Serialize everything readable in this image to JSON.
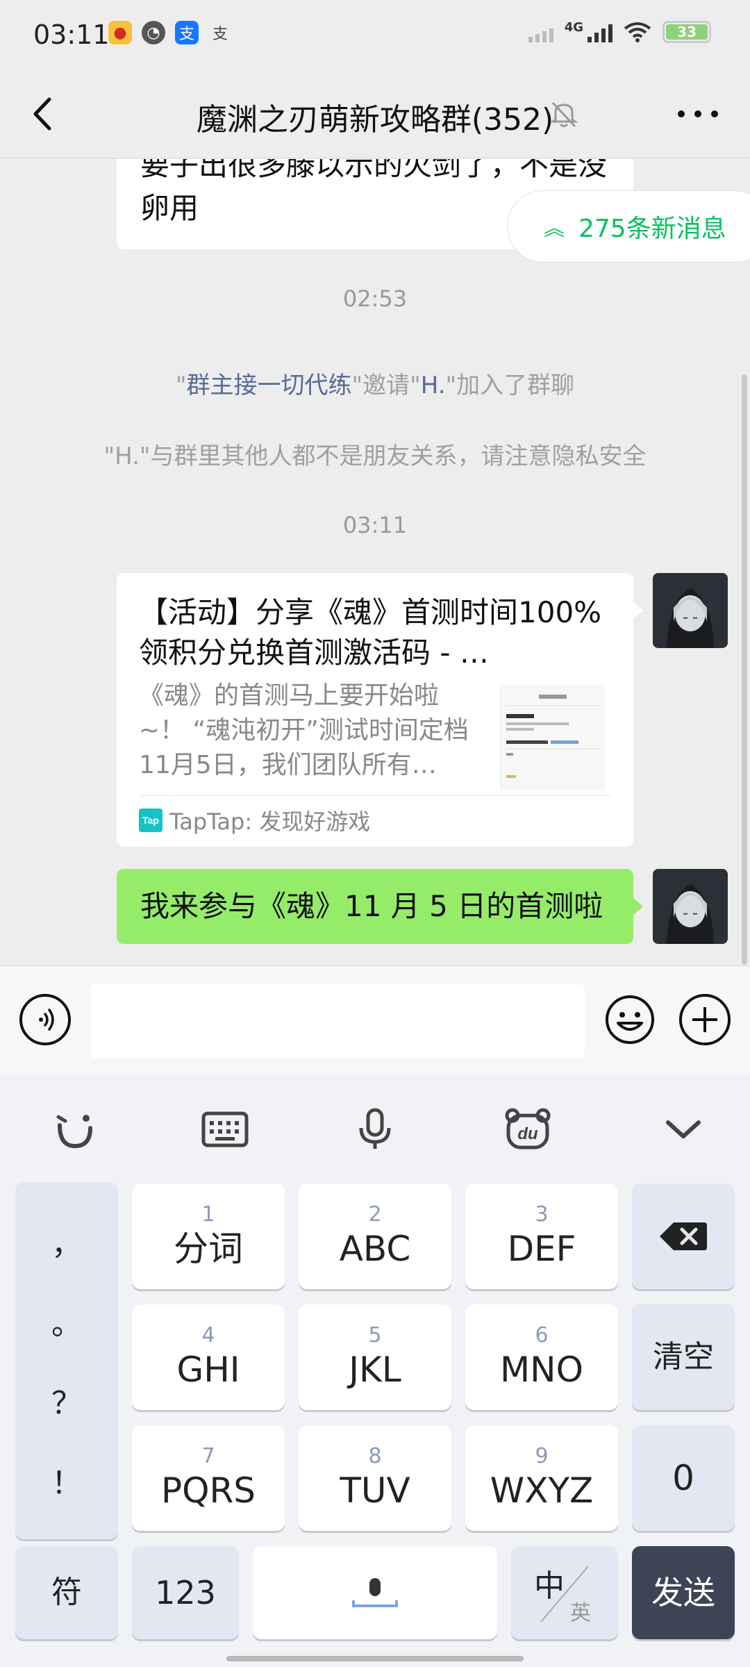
{
  "status_bar": {
    "time": "03:11",
    "network": "4G",
    "battery": "33",
    "app_icons": [
      "weibo-icon",
      "compass-icon",
      "alipay-icon",
      "alipay-outline-icon"
    ]
  },
  "header": {
    "back_icon": "chevron-left-icon",
    "title": "魔渊之刃萌新攻略群(352)",
    "mute_icon": "bell-muted-icon",
    "more_icon": "more-dots-icon"
  },
  "chat": {
    "prev_message_fragment": "要子出很多滕以示的火剑了，不是没卵用",
    "new_messages_pill": "275条新消息",
    "timestamp_1": "02:53",
    "system_invite": {
      "q1": "\"",
      "inviter": "群主接一切代练",
      "mid": "\"邀请\"",
      "invitee": "H.",
      "tail": "\"加入了群聊"
    },
    "system_privacy": "\"H.\"与群里其他人都不是朋友关系，请注意隐私安全",
    "timestamp_2": "03:11",
    "link_card": {
      "title": "【活动】分享《魂》首测时间100%领积分兑换首测激活码 - …",
      "description": "《魂》的首测马上要开始啦~！ “魂沌初开”测试时间定档11月5日，我们团队所有…",
      "source": "TapTap: 发现好游戏",
      "source_icon_text": "Tap"
    },
    "sent_message": "我来参与《魂》11 月 5 日的首测啦"
  },
  "input_bar": {
    "voice_icon": "voice-icon",
    "input_value": "",
    "emoji_icon": "emoji-icon",
    "plus_icon": "plus-circle-icon"
  },
  "keyboard": {
    "toolbar": [
      "smile-logo-icon",
      "keyboard-icon",
      "microphone-icon",
      "du-bear-icon",
      "chevron-down-icon"
    ],
    "punctuation": [
      "，",
      "。",
      "？",
      "！"
    ],
    "keys": [
      {
        "num": "1",
        "label": "分词"
      },
      {
        "num": "2",
        "label": "ABC"
      },
      {
        "num": "3",
        "label": "DEF"
      },
      {
        "num": "4",
        "label": "GHI"
      },
      {
        "num": "5",
        "label": "JKL"
      },
      {
        "num": "6",
        "label": "MNO"
      },
      {
        "num": "7",
        "label": "PQRS"
      },
      {
        "num": "8",
        "label": "TUV"
      },
      {
        "num": "9",
        "label": "WXYZ"
      }
    ],
    "clear_label": "清空",
    "zero_label": "0",
    "symbol_label": "符",
    "numeric_label": "123",
    "lang_main": "中",
    "lang_alt": "英",
    "send_label": "发送"
  }
}
